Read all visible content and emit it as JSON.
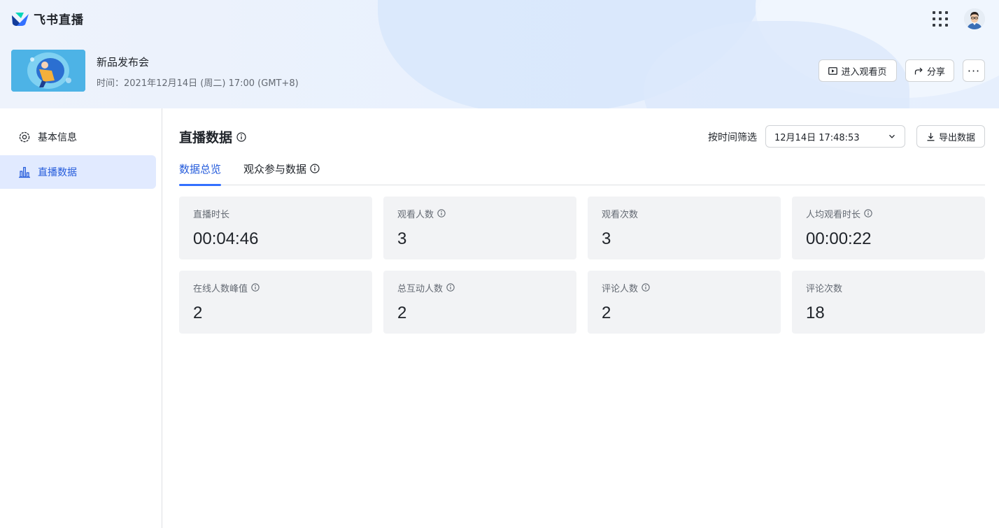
{
  "brand": {
    "name": "飞书直播"
  },
  "event": {
    "title": "新品发布会",
    "time": "时间：2021年12月14日 (周二) 17:00 (GMT+8)"
  },
  "header_actions": {
    "watch_label": "进入观看页",
    "share_label": "分享",
    "more_label": "···"
  },
  "sidebar": {
    "items": [
      {
        "label": "基本信息",
        "icon": "gear-icon",
        "active": false
      },
      {
        "label": "直播数据",
        "icon": "bar-chart-icon",
        "active": true
      }
    ]
  },
  "main": {
    "title": "直播数据",
    "filter_label": "按时间筛选",
    "filter_value": "12月14日 17:48:53",
    "export_label": "导出数据",
    "tabs": [
      {
        "label": "数据总览",
        "active": true
      },
      {
        "label": "观众参与数据",
        "active": false
      }
    ],
    "stats": [
      {
        "label": "直播时长",
        "value": "00:04:46",
        "info": false
      },
      {
        "label": "观看人数",
        "value": "3",
        "info": true
      },
      {
        "label": "观看次数",
        "value": "3",
        "info": false
      },
      {
        "label": "人均观看时长",
        "value": "00:00:22",
        "info": true
      },
      {
        "label": "在线人数峰值",
        "value": "2",
        "info": true
      },
      {
        "label": "总互动人数",
        "value": "2",
        "info": true
      },
      {
        "label": "评论人数",
        "value": "2",
        "info": true
      },
      {
        "label": "评论次数",
        "value": "18",
        "info": false
      }
    ]
  },
  "colors": {
    "accent": "#3370ff",
    "accent_text": "#245bdb",
    "active_bg": "#e1eaff",
    "card_bg": "#f2f3f5"
  }
}
